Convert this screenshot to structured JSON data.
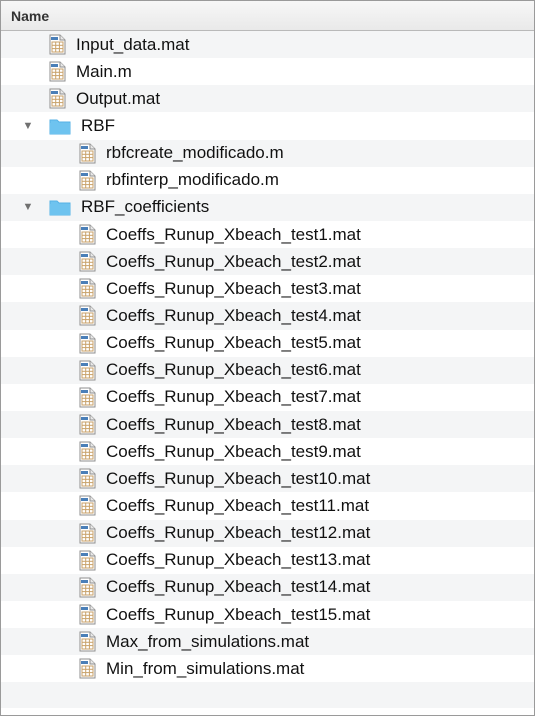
{
  "header": {
    "name_label": "Name"
  },
  "rows": [
    {
      "label": "Input_data.mat",
      "kind": "file",
      "level": 0
    },
    {
      "label": "Main.m",
      "kind": "file",
      "level": 0
    },
    {
      "label": "Output.mat",
      "kind": "file",
      "level": 0
    },
    {
      "label": "RBF",
      "kind": "folder",
      "level": 0,
      "expanded": true
    },
    {
      "label": "rbfcreate_modificado.m",
      "kind": "file",
      "level": 1
    },
    {
      "label": "rbfinterp_modificado.m",
      "kind": "file",
      "level": 1
    },
    {
      "label": "RBF_coefficients",
      "kind": "folder",
      "level": 0,
      "expanded": true
    },
    {
      "label": "Coeffs_Runup_Xbeach_test1.mat",
      "kind": "file",
      "level": 1
    },
    {
      "label": "Coeffs_Runup_Xbeach_test2.mat",
      "kind": "file",
      "level": 1
    },
    {
      "label": "Coeffs_Runup_Xbeach_test3.mat",
      "kind": "file",
      "level": 1
    },
    {
      "label": "Coeffs_Runup_Xbeach_test4.mat",
      "kind": "file",
      "level": 1
    },
    {
      "label": "Coeffs_Runup_Xbeach_test5.mat",
      "kind": "file",
      "level": 1
    },
    {
      "label": "Coeffs_Runup_Xbeach_test6.mat",
      "kind": "file",
      "level": 1
    },
    {
      "label": "Coeffs_Runup_Xbeach_test7.mat",
      "kind": "file",
      "level": 1
    },
    {
      "label": "Coeffs_Runup_Xbeach_test8.mat",
      "kind": "file",
      "level": 1
    },
    {
      "label": "Coeffs_Runup_Xbeach_test9.mat",
      "kind": "file",
      "level": 1
    },
    {
      "label": "Coeffs_Runup_Xbeach_test10.mat",
      "kind": "file",
      "level": 1
    },
    {
      "label": "Coeffs_Runup_Xbeach_test11.mat",
      "kind": "file",
      "level": 1
    },
    {
      "label": "Coeffs_Runup_Xbeach_test12.mat",
      "kind": "file",
      "level": 1
    },
    {
      "label": "Coeffs_Runup_Xbeach_test13.mat",
      "kind": "file",
      "level": 1
    },
    {
      "label": "Coeffs_Runup_Xbeach_test14.mat",
      "kind": "file",
      "level": 1
    },
    {
      "label": "Coeffs_Runup_Xbeach_test15.mat",
      "kind": "file",
      "level": 1
    },
    {
      "label": "Max_from_simulations.mat",
      "kind": "file",
      "level": 1
    },
    {
      "label": "Min_from_simulations.mat",
      "kind": "file",
      "level": 1
    }
  ],
  "colors": {
    "folder": "#6ec3ef",
    "folder_tab": "#55b2e6",
    "file_grid": "#c9a26a"
  }
}
